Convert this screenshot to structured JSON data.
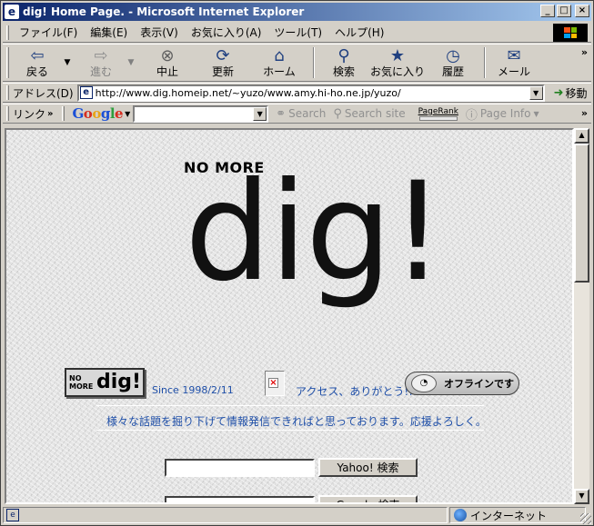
{
  "window": {
    "title": "dig! Home Page. - Microsoft Internet Explorer",
    "controls": {
      "minimize": "_",
      "maximize": "□",
      "close": "×"
    }
  },
  "menubar": {
    "items": [
      "ファイル(F)",
      "編集(E)",
      "表示(V)",
      "お気に入り(A)",
      "ツール(T)",
      "ヘルプ(H)"
    ]
  },
  "toolbar": {
    "back": "戻る",
    "forward": "進む",
    "stop": "中止",
    "refresh": "更新",
    "home": "ホーム",
    "search": "検索",
    "favorites": "お気に入り",
    "history": "履歴",
    "mail": "メール",
    "more": "»"
  },
  "address": {
    "label": "アドレス(D)",
    "url": "http://www.dig.homeip.net/~yuzo/www.amy.hi-ho.ne.jp/yuzo/",
    "go": "移動"
  },
  "links": {
    "label": "リンク",
    "chevron": "»",
    "google_logo": "Google",
    "search_btn": "Search",
    "search_site_btn": "Search site",
    "pagerank": "PageRank",
    "page_info": "Page Info",
    "more": "»"
  },
  "page": {
    "nomore": "NO MORE",
    "logo": "dig!",
    "banner_small": "NO MORE",
    "banner_big": "dig!",
    "since": "Since 1998/2/11",
    "thanks": "アクセス、ありがとう!!",
    "offline": "オフラインです",
    "message": "様々な話題を掘り下げて情報発信できればと思っております。応援よろしく。",
    "yahoo_search": "Yahoo! 検索",
    "google_search": "Google 検索"
  },
  "statusbar": {
    "zone": "インターネット"
  }
}
